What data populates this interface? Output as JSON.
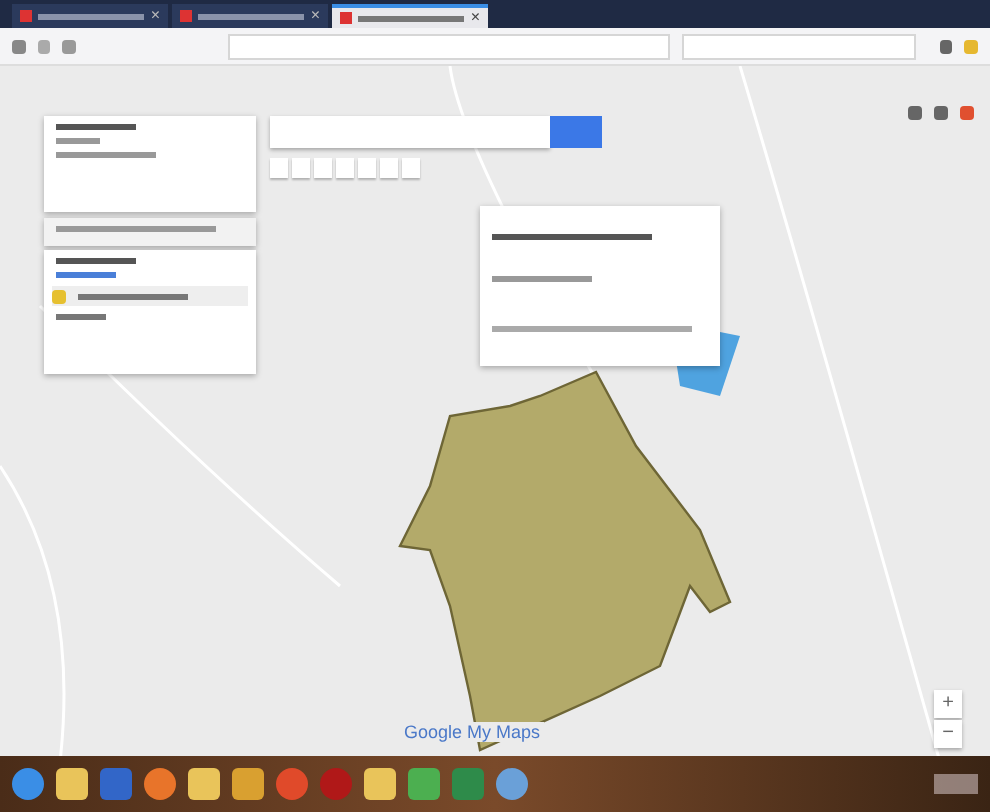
{
  "browser": {
    "tabs": [
      {
        "selected": false,
        "close": "×"
      },
      {
        "selected": false,
        "close": "×"
      },
      {
        "selected": true,
        "close": "×"
      }
    ]
  },
  "map": {
    "attribution": "Google My Maps",
    "zoom_in": "+",
    "zoom_out": "−"
  },
  "taskbar": {
    "apps": [
      {
        "kind": "start"
      },
      {
        "kind": "folder"
      },
      {
        "kind": "media"
      },
      {
        "kind": "browser"
      },
      {
        "kind": "folder"
      },
      {
        "kind": "paint"
      },
      {
        "kind": "chrome"
      },
      {
        "kind": "red"
      },
      {
        "kind": "folder"
      },
      {
        "kind": "torrent"
      },
      {
        "kind": "sheet"
      },
      {
        "kind": "globe"
      }
    ]
  }
}
